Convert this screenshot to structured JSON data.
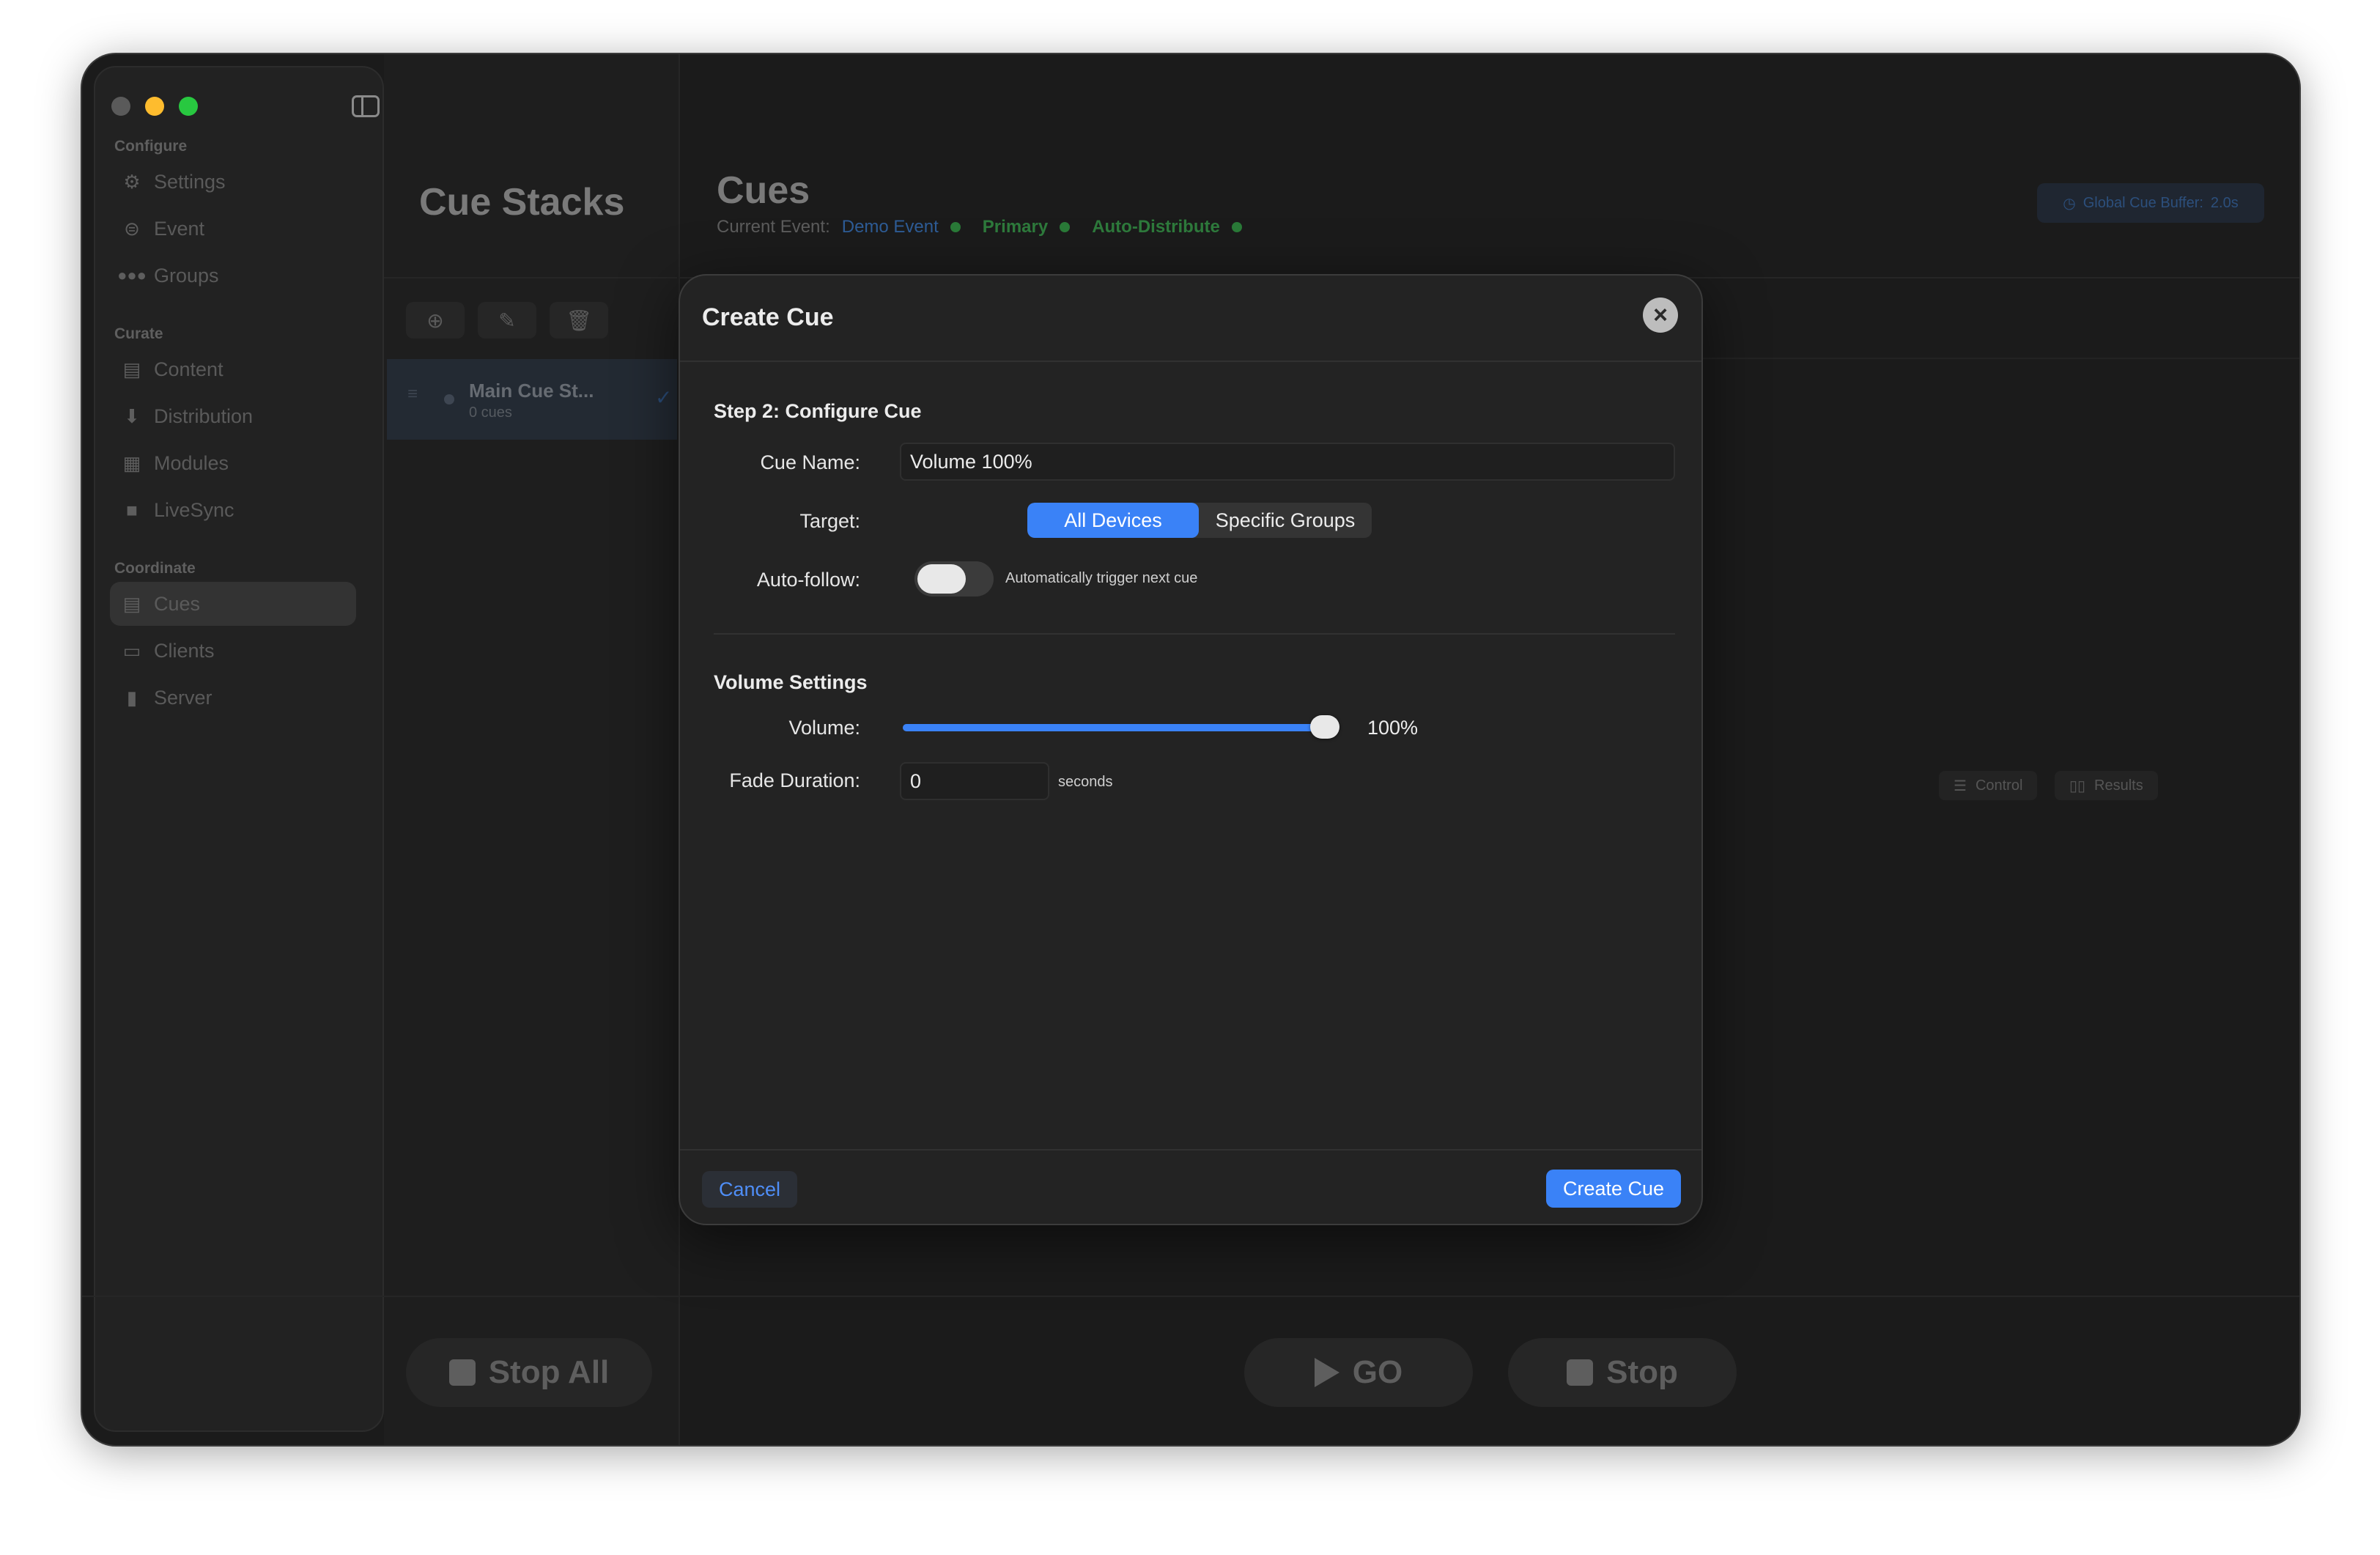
{
  "sidebar": {
    "sections": {
      "configure": "Configure",
      "curate": "Curate",
      "coordinate": "Coordinate"
    },
    "items": [
      {
        "label": "Settings",
        "icon": "gear-icon"
      },
      {
        "label": "Event",
        "icon": "event-icon"
      },
      {
        "label": "Groups",
        "icon": "people-icon"
      },
      {
        "label": "Content",
        "icon": "content-icon"
      },
      {
        "label": "Distribution",
        "icon": "download-icon"
      },
      {
        "label": "Modules",
        "icon": "grid-icon"
      },
      {
        "label": "LiveSync",
        "icon": "camera-icon"
      },
      {
        "label": "Cues",
        "icon": "list-icon",
        "active": true
      },
      {
        "label": "Clients",
        "icon": "devices-icon"
      },
      {
        "label": "Server",
        "icon": "chart-icon"
      }
    ]
  },
  "stacks": {
    "title": "Cue Stacks",
    "row": {
      "name": "Main Cue St...",
      "count": "0 cues"
    },
    "stop_all": "Stop All"
  },
  "main": {
    "title": "Cues",
    "event_label": "Current Event:",
    "event_name": "Demo Event",
    "primary": "Primary",
    "auto_distribute": "Auto-Distribute",
    "buffer_label": "Global Cue Buffer:",
    "buffer_value": "2.0s",
    "control_tab": "Control",
    "results_tab": "Results",
    "go": "GO",
    "stop": "Stop"
  },
  "modal": {
    "title": "Create Cue",
    "step_title": "Step 2: Configure Cue",
    "cue_name_label": "Cue Name:",
    "cue_name_value": "Volume 100%",
    "target_label": "Target:",
    "target_options": [
      "All Devices",
      "Specific Groups"
    ],
    "target_selected": "All Devices",
    "autofollow_label": "Auto-follow:",
    "autofollow_hint": "Automatically trigger next cue",
    "autofollow_on": false,
    "volume_section": "Volume Settings",
    "volume_label": "Volume:",
    "volume_value": "100%",
    "volume_level": 1.0,
    "fade_label": "Fade Duration:",
    "fade_value": "0",
    "fade_unit": "seconds",
    "cancel": "Cancel",
    "create": "Create Cue"
  },
  "colors": {
    "accent": "#3a82f7",
    "status_green": "#2e7a3c",
    "close": "#ff5f57",
    "minimize": "#febc2e",
    "zoom": "#28c840"
  }
}
